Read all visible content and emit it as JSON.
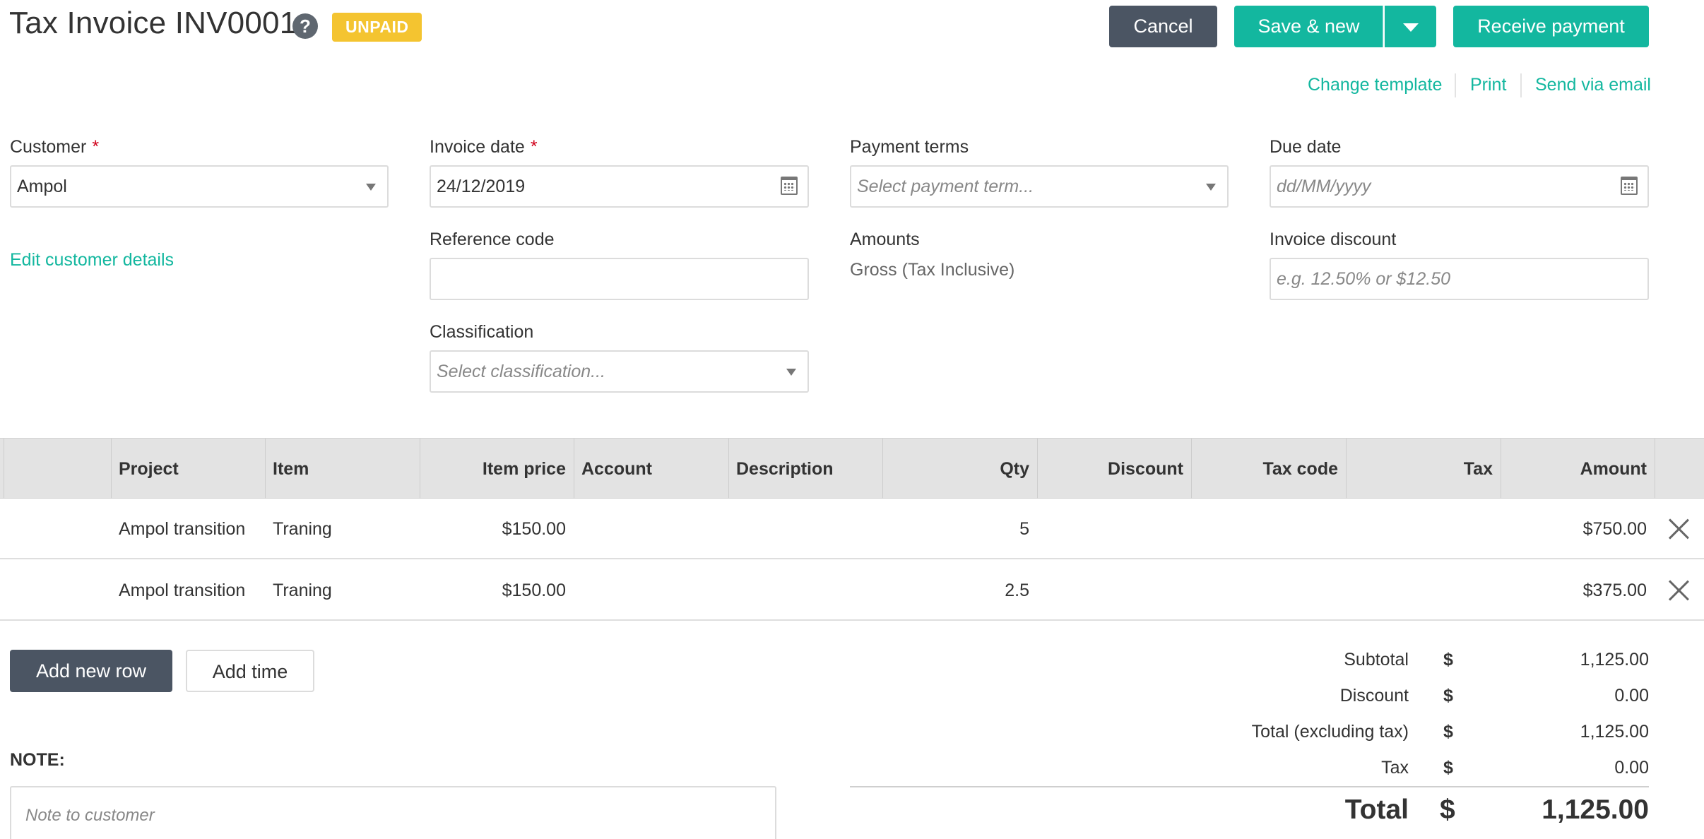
{
  "header": {
    "title": "Tax Invoice INV0001",
    "status": "UNPAID",
    "status_color": "#f4c430",
    "cancel_label": "Cancel",
    "save_new_label": "Save & new",
    "receive_payment_label": "Receive payment",
    "change_template_label": "Change template",
    "print_label": "Print",
    "send_email_label": "Send via email",
    "accent_color": "#13b79f",
    "dark_button_color": "#4b5563"
  },
  "form": {
    "customer_label": "Customer",
    "customer_value": "Ampol",
    "edit_customer_label": "Edit customer details",
    "invoice_date_label": "Invoice date",
    "invoice_date_value": "24/12/2019",
    "payment_terms_label": "Payment terms",
    "payment_terms_placeholder": "Select payment term...",
    "due_date_label": "Due date",
    "due_date_placeholder": "dd/MM/yyyy",
    "reference_code_label": "Reference code",
    "reference_code_value": "",
    "amounts_label": "Amounts",
    "amounts_value": "Gross (Tax Inclusive)",
    "invoice_discount_label": "Invoice discount",
    "invoice_discount_placeholder": "e.g. 12.50% or $12.50",
    "classification_label": "Classification",
    "classification_placeholder": "Select classification..."
  },
  "table": {
    "columns": [
      "Project",
      "Item",
      "Item price",
      "Account",
      "Description",
      "Qty",
      "Discount",
      "Tax code",
      "Tax",
      "Amount"
    ],
    "rows": [
      {
        "project": "Ampol transition",
        "item": "Traning",
        "item_price": "$150.00",
        "account": "",
        "description": "",
        "qty": "5",
        "discount": "",
        "tax_code": "",
        "tax": "",
        "amount": "$750.00"
      },
      {
        "project": "Ampol transition",
        "item": "Traning",
        "item_price": "$150.00",
        "account": "",
        "description": "",
        "qty": "2.5",
        "discount": "",
        "tax_code": "",
        "tax": "",
        "amount": "$375.00"
      }
    ]
  },
  "actions": {
    "add_row_label": "Add new row",
    "add_time_label": "Add time"
  },
  "note": {
    "label": "NOTE:",
    "placeholder": "Note to customer"
  },
  "totals": {
    "currency": "$",
    "subtotal_label": "Subtotal",
    "subtotal_value": "1,125.00",
    "discount_label": "Discount",
    "discount_value": "0.00",
    "total_ex_tax_label": "Total (excluding tax)",
    "total_ex_tax_value": "1,125.00",
    "tax_label": "Tax",
    "tax_value": "0.00",
    "total_label": "Total",
    "total_value": "1,125.00"
  }
}
